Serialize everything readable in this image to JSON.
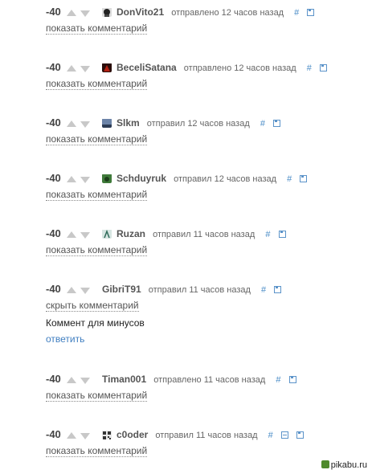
{
  "comments": [
    {
      "score": "-40",
      "user": "DonVito21",
      "time": "отправлено 12 часов назад",
      "hash": "#",
      "toggle": "показать комментарий"
    },
    {
      "score": "-40",
      "user": "BeceliSatana",
      "time": "отправлено 12 часов назад",
      "hash": "#",
      "toggle": "показать комментарий"
    },
    {
      "score": "-40",
      "user": "Slkm",
      "time": "отправил 12 часов назад",
      "hash": "#",
      "toggle": "показать комментарий"
    },
    {
      "score": "-40",
      "user": "Schduyruk",
      "time": "отправил 12 часов назад",
      "hash": "#",
      "toggle": "показать комментарий"
    },
    {
      "score": "-40",
      "user": "Ruzan",
      "time": "отправил 11 часов назад",
      "hash": "#",
      "toggle": "показать комментарий"
    },
    {
      "score": "-40",
      "user": "GibriT91",
      "time": "отправил 11 часов назад",
      "hash": "#",
      "toggle": "скрыть комментарий",
      "body": "Коммент для минусов",
      "reply": "ответить"
    },
    {
      "score": "-40",
      "user": "Timan001",
      "time": "отправлено 11 часов назад",
      "hash": "#",
      "toggle": "показать комментарий"
    },
    {
      "score": "-40",
      "user": "c0oder",
      "time": "отправил 11 часов назад",
      "hash": "#",
      "toggle": "показать комментарий"
    }
  ],
  "watermark": "pikabu.ru",
  "icons": {
    "vote_up": "up-arrow-icon",
    "vote_down": "down-arrow-icon",
    "save": "save-icon",
    "collapse": "minus-icon"
  },
  "colors": {
    "link": "#4a8cc7",
    "arrow": "#c8c8c8"
  }
}
